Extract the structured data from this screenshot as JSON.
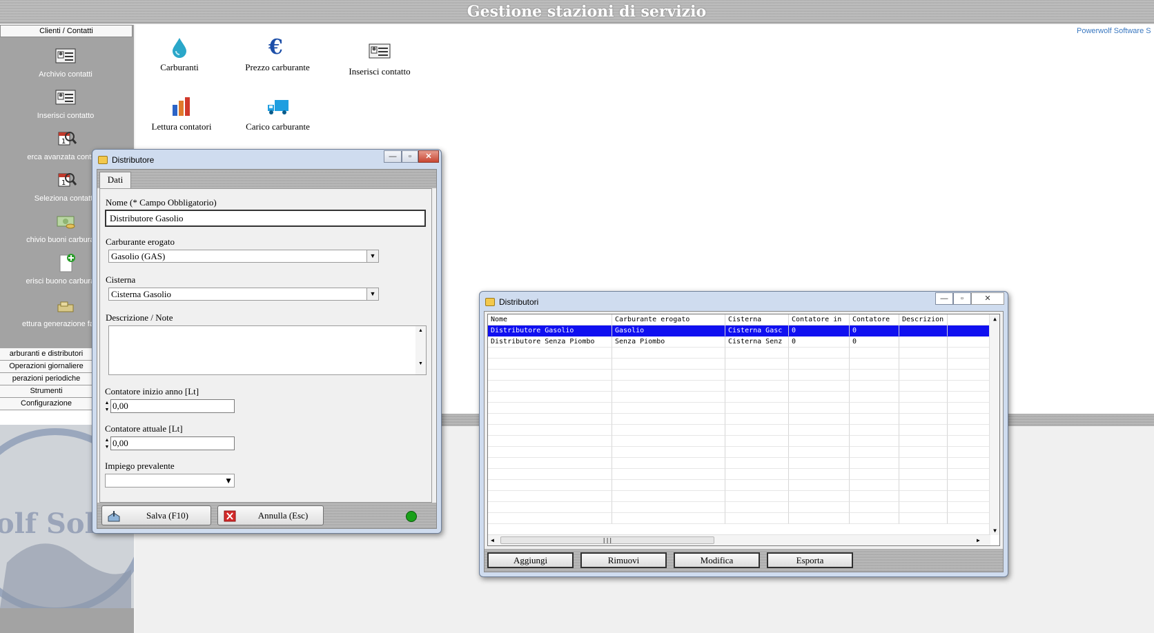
{
  "app": {
    "title": "Gestione stazioni di servizio",
    "vendor": "Powerwolf Software S"
  },
  "sidebar": {
    "header": "Clienti / Contatti",
    "items": [
      {
        "label": "Archivio contatti",
        "icon": "contact-card-icon"
      },
      {
        "label": "Inserisci contatto",
        "icon": "contact-card-icon"
      },
      {
        "label": "erca avanzata contatto",
        "icon": "calendar-search-icon"
      },
      {
        "label": "Seleziona contatto",
        "icon": "calendar-search-icon"
      },
      {
        "label": "chivio buoni carburante",
        "icon": "money-icon"
      },
      {
        "label": "erisci buono carburante",
        "icon": "document-add-icon"
      },
      {
        "label": "ettura generazione fattura",
        "icon": "money-stack-icon"
      }
    ],
    "categories": [
      "arburanti e distributori",
      "Operazioni giornaliere",
      "perazioni periodiche",
      "Strumenti",
      "Configurazione"
    ],
    "logo_text": "olf Solut"
  },
  "shortcuts": [
    {
      "label": "Carburanti",
      "icon": "water-drop-icon"
    },
    {
      "label": "Prezzo carburante",
      "icon": "euro-icon"
    },
    {
      "label": "Inserisci contatto",
      "icon": "contact-card-icon"
    },
    {
      "label": "Lettura contatori",
      "icon": "bar-chart-icon"
    },
    {
      "label": "Carico carburante",
      "icon": "truck-icon"
    }
  ],
  "dialog": {
    "title": "Distributore",
    "tab": "Dati",
    "name_label": "Nome (* Campo Obbligatorio)",
    "name_value": "Distributore Gasolio",
    "fuel_label": "Carburante erogato",
    "fuel_value": "Gasolio (GAS)",
    "tank_label": "Cisterna",
    "tank_value": "Cisterna Gasolio",
    "notes_label": "Descrizione / Note",
    "notes_value": "",
    "counter_start_label": "Contatore inizio anno [Lt]",
    "counter_start_value": "0,00",
    "counter_current_label": "Contatore attuale [Lt]",
    "counter_current_value": "0,00",
    "usage_label": "Impiego prevalente",
    "usage_value": "",
    "save_label": "Salva (F10)",
    "cancel_label": "Annulla (Esc)",
    "status_color": "#1aa01a"
  },
  "list_window": {
    "title": "Distributori",
    "columns": [
      "Nome",
      "Carburante erogato",
      "Cisterna",
      "Contatore in",
      "Contatore",
      "Descrizion"
    ],
    "rows": [
      [
        "Distributore Gasolio",
        "Gasolio",
        "Cisterna Gasc",
        "0",
        "0",
        ""
      ],
      [
        "Distributore Senza Piombo",
        "Senza Piombo",
        "Cisterna Senz",
        "0",
        "0",
        ""
      ]
    ],
    "selected_row": 0,
    "buttons": {
      "add": "Aggiungi",
      "remove": "Rimuovi",
      "edit": "Modifica",
      "export": "Esporta"
    }
  },
  "colors": {
    "selection": "#1010f0",
    "sidebar": "#a3a3a3",
    "vendor_link": "#3a78c0"
  }
}
